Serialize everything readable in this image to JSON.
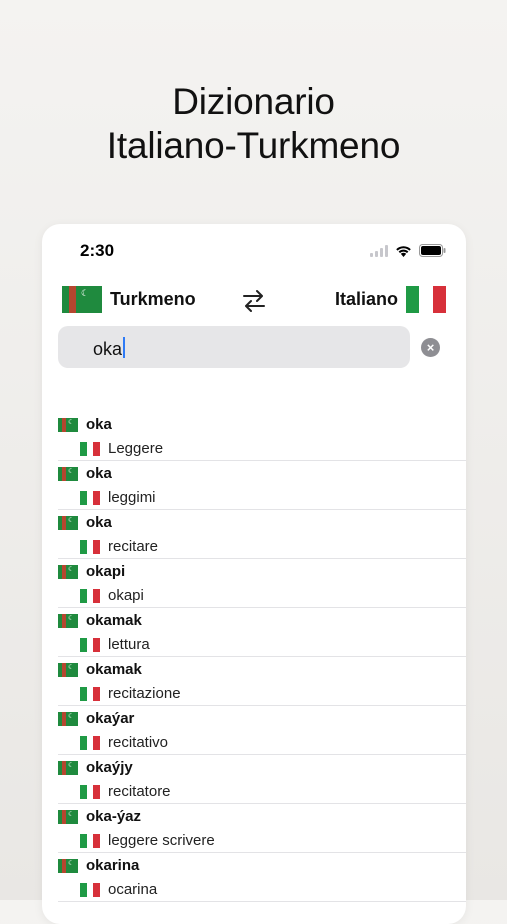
{
  "headline": {
    "line1": "Dizionario",
    "line2": "Italiano-Turkmeno"
  },
  "status_bar": {
    "time": "2:30"
  },
  "language_bar": {
    "source_language": "Turkmeno",
    "target_language": "Italiano",
    "swap_icon": "swap-arrows-icon"
  },
  "search": {
    "value": "oka",
    "placeholder": ""
  },
  "colors": {
    "turkmen_green": "#1f8a3e",
    "italy_green": "#1f9a45",
    "italy_red": "#d7303a",
    "caret_blue": "#2f7bf6"
  },
  "results": [
    {
      "word": "oka",
      "translation": "Leggere"
    },
    {
      "word": "oka",
      "translation": "leggimi"
    },
    {
      "word": "oka",
      "translation": "recitare"
    },
    {
      "word": "okapi",
      "translation": "okapi"
    },
    {
      "word": "okamak",
      "translation": "lettura"
    },
    {
      "word": "okamak",
      "translation": "recitazione"
    },
    {
      "word": "okaýar",
      "translation": "recitativo"
    },
    {
      "word": "okaýjy",
      "translation": "recitatore"
    },
    {
      "word": "oka-ýaz",
      "translation": "leggere scrivere"
    },
    {
      "word": "okarina",
      "translation": "ocarina"
    }
  ]
}
